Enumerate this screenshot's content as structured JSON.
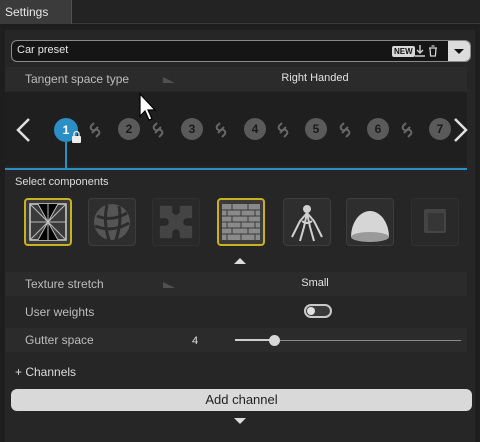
{
  "tabs": [
    {
      "label": "Settings"
    }
  ],
  "preset": {
    "label": "Car preset",
    "new_badge": "NEW"
  },
  "properties": {
    "tangent_space": {
      "label": "Tangent space type",
      "value": "Right Handed"
    },
    "texture_stretch": {
      "label": "Texture stretch",
      "value": "Small"
    },
    "user_weights": {
      "label": "User weights",
      "enabled": false
    },
    "gutter_space": {
      "label": "Gutter space",
      "value": "4"
    }
  },
  "steps": {
    "current": "1",
    "items": [
      "1",
      "2",
      "3",
      "4",
      "5",
      "6",
      "7"
    ]
  },
  "components": {
    "title": "Select components",
    "items": [
      {
        "icon": "mesh-icon",
        "active": true
      },
      {
        "icon": "sphere-icon",
        "active": false
      },
      {
        "icon": "puzzle-icon",
        "active": false,
        "disabled": true
      },
      {
        "icon": "brick-icon",
        "active": true
      },
      {
        "icon": "body-icon",
        "active": false
      },
      {
        "icon": "dome-icon",
        "active": false
      },
      {
        "icon": "layer-icon",
        "active": false,
        "disabled": true
      }
    ]
  },
  "channels": {
    "label": "+ Channels",
    "add_button": "Add channel"
  },
  "colors": {
    "accent": "#2a8fc4",
    "highlight": "#c9b21e"
  }
}
